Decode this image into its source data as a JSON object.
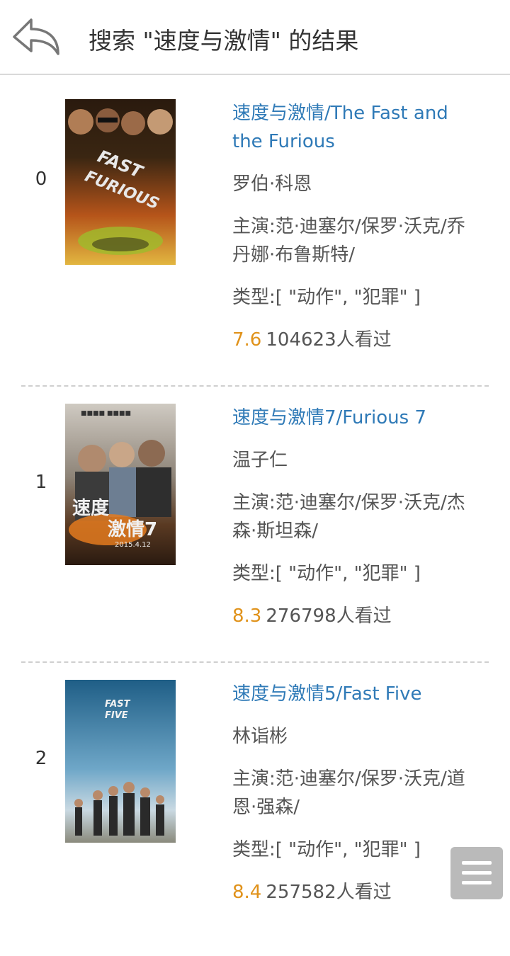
{
  "header": {
    "title": "搜索 \"速度与激情\" 的结果"
  },
  "results": [
    {
      "index": "0",
      "title": "速度与激情/The Fast and the Furious",
      "director": "罗伯·科恩",
      "cast": "主演:范·迪塞尔/保罗·沃克/乔丹娜·布鲁斯特/",
      "genre": "类型:[ \"动作\", \"犯罪\" ]",
      "rating": "7.6",
      "views": "104623人看过",
      "poster_icon": "poster-fast-and-furious"
    },
    {
      "index": "1",
      "title": "速度与激情7/Furious 7",
      "director": "温子仁",
      "cast": "主演:范·迪塞尔/保罗·沃克/杰森·斯坦森/",
      "genre": "类型:[ \"动作\", \"犯罪\" ]",
      "rating": "8.3",
      "views": "276798人看过",
      "poster_icon": "poster-furious-7"
    },
    {
      "index": "2",
      "title": "速度与激情5/Fast Five",
      "director": "林诣彬",
      "cast": "主演:范·迪塞尔/保罗·沃克/道恩·强森/",
      "genre": "类型:[ \"动作\", \"犯罪\" ]",
      "rating": "8.4",
      "views": "257582人看过",
      "poster_icon": "poster-fast-five"
    }
  ],
  "colors": {
    "link": "#2f7ab7",
    "rating": "#e0921a",
    "text": "#555555"
  }
}
